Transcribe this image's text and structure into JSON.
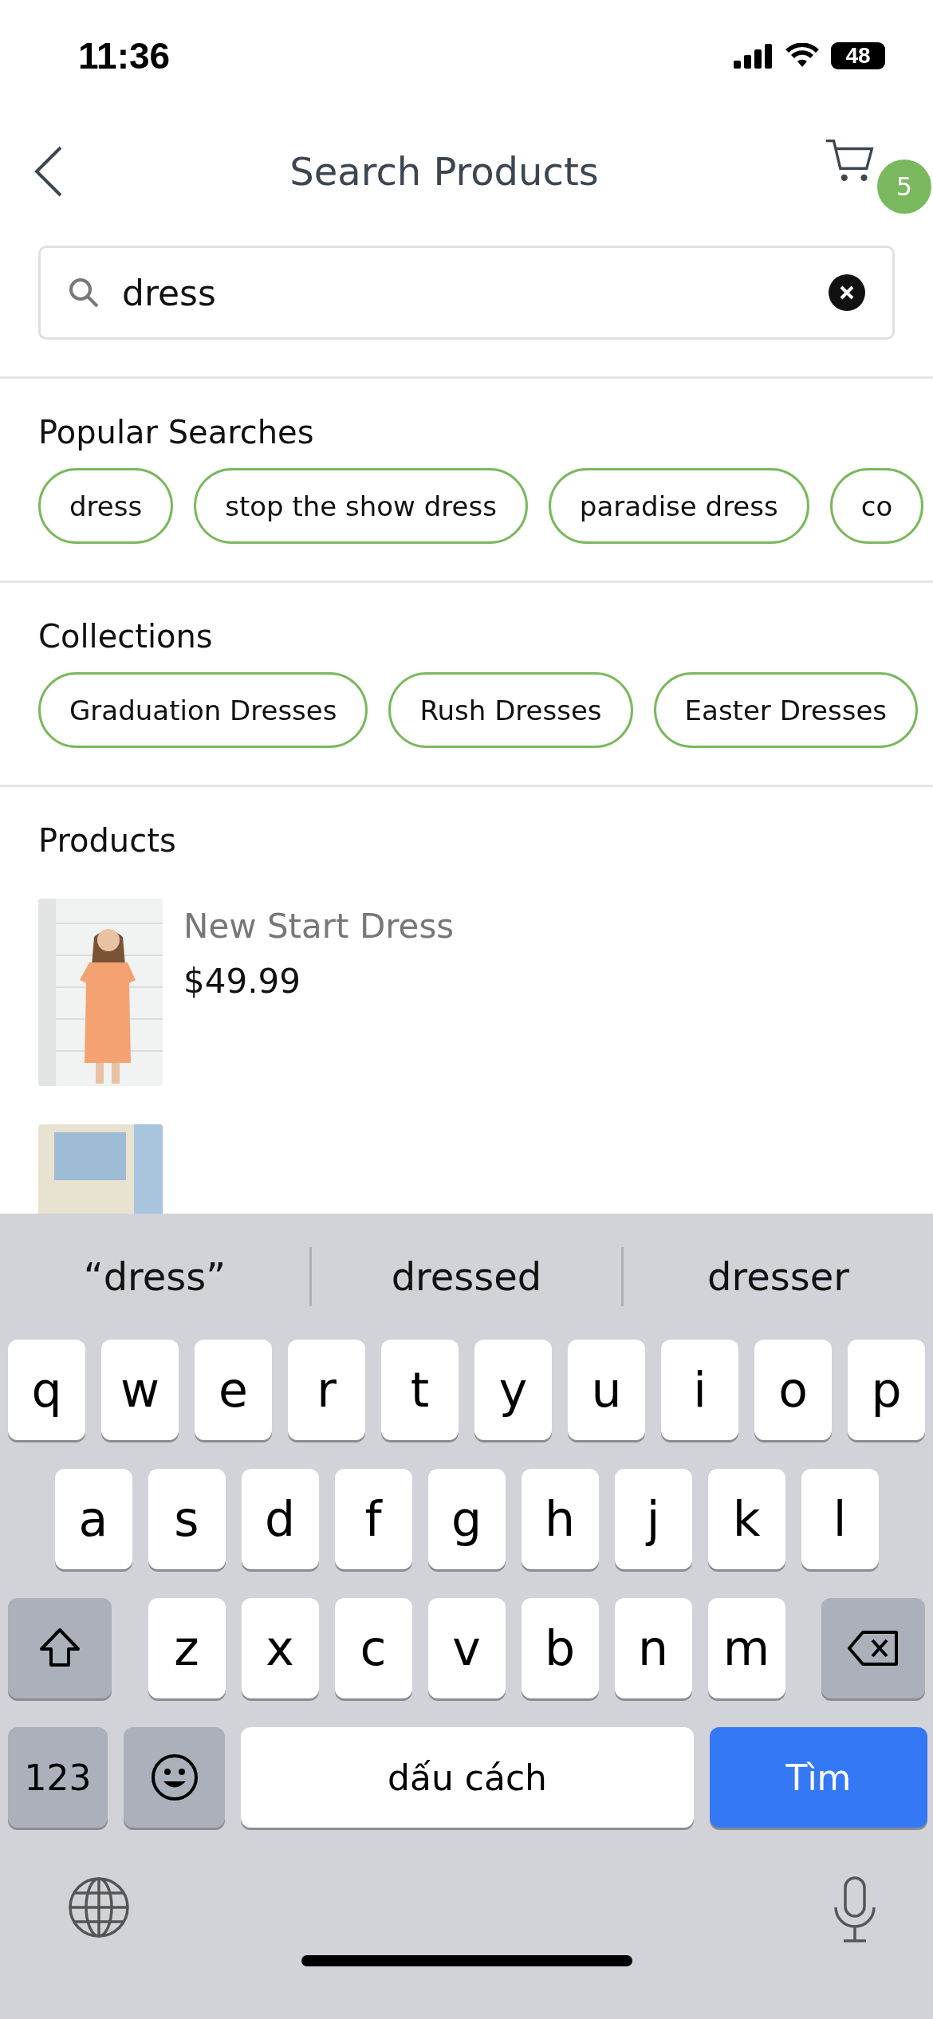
{
  "status_bar": {
    "time": "11:36",
    "battery": "48"
  },
  "header": {
    "title": "Search Products",
    "cart_count": "5"
  },
  "search": {
    "value": "dress"
  },
  "sections": [
    {
      "kind": "chips",
      "title": "Popular Searches",
      "chips": [
        "dress",
        "stop the show dress",
        "paradise dress",
        "co"
      ]
    },
    {
      "kind": "chips",
      "title": "Collections",
      "chips": [
        "Graduation Dresses",
        "Rush Dresses",
        "Easter Dresses"
      ]
    },
    {
      "kind": "products",
      "title": "Products",
      "products": [
        {
          "kind": "full",
          "name": "New Start Dress",
          "price": "$49.99"
        },
        {
          "kind": "picture"
        }
      ]
    }
  ],
  "keyboard": {
    "suggestions": [
      "“dress”",
      "dressed",
      "dresser"
    ],
    "rows": [
      [
        "q",
        "w",
        "e",
        "r",
        "t",
        "y",
        "u",
        "i",
        "o",
        "p"
      ],
      [
        "a",
        "s",
        "d",
        "f",
        "g",
        "h",
        "j",
        "k",
        "l"
      ],
      [
        "z",
        "x",
        "c",
        "v",
        "b",
        "n",
        "m"
      ]
    ],
    "number_key": "123",
    "space": "dấu cách",
    "action": "Tìm"
  }
}
